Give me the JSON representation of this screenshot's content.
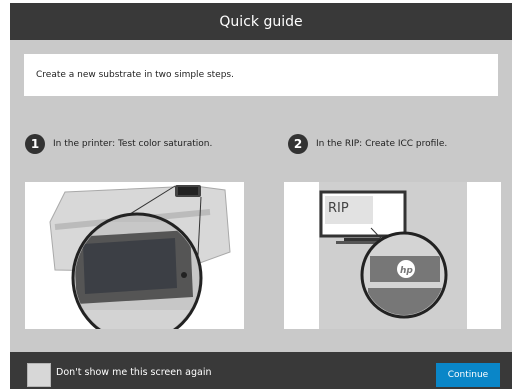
{
  "header": {
    "title": "Quick guide"
  },
  "intro": {
    "text": "Create a new substrate in two simple steps."
  },
  "steps": [
    {
      "number": "1",
      "label": "In the printer: Test color saturation."
    },
    {
      "number": "2",
      "label": "In the RIP: Create ICC profile."
    }
  ],
  "illustration_rip": {
    "screen_text": "RIP",
    "logo_text": "hp"
  },
  "footer": {
    "checkbox_label": "Don't show me this screen again",
    "checkbox_checked": false,
    "continue_label": "Continue"
  },
  "colors": {
    "header_bg": "#393939",
    "panel_bg": "#c9c9c9",
    "accent": "#0a86c8"
  }
}
